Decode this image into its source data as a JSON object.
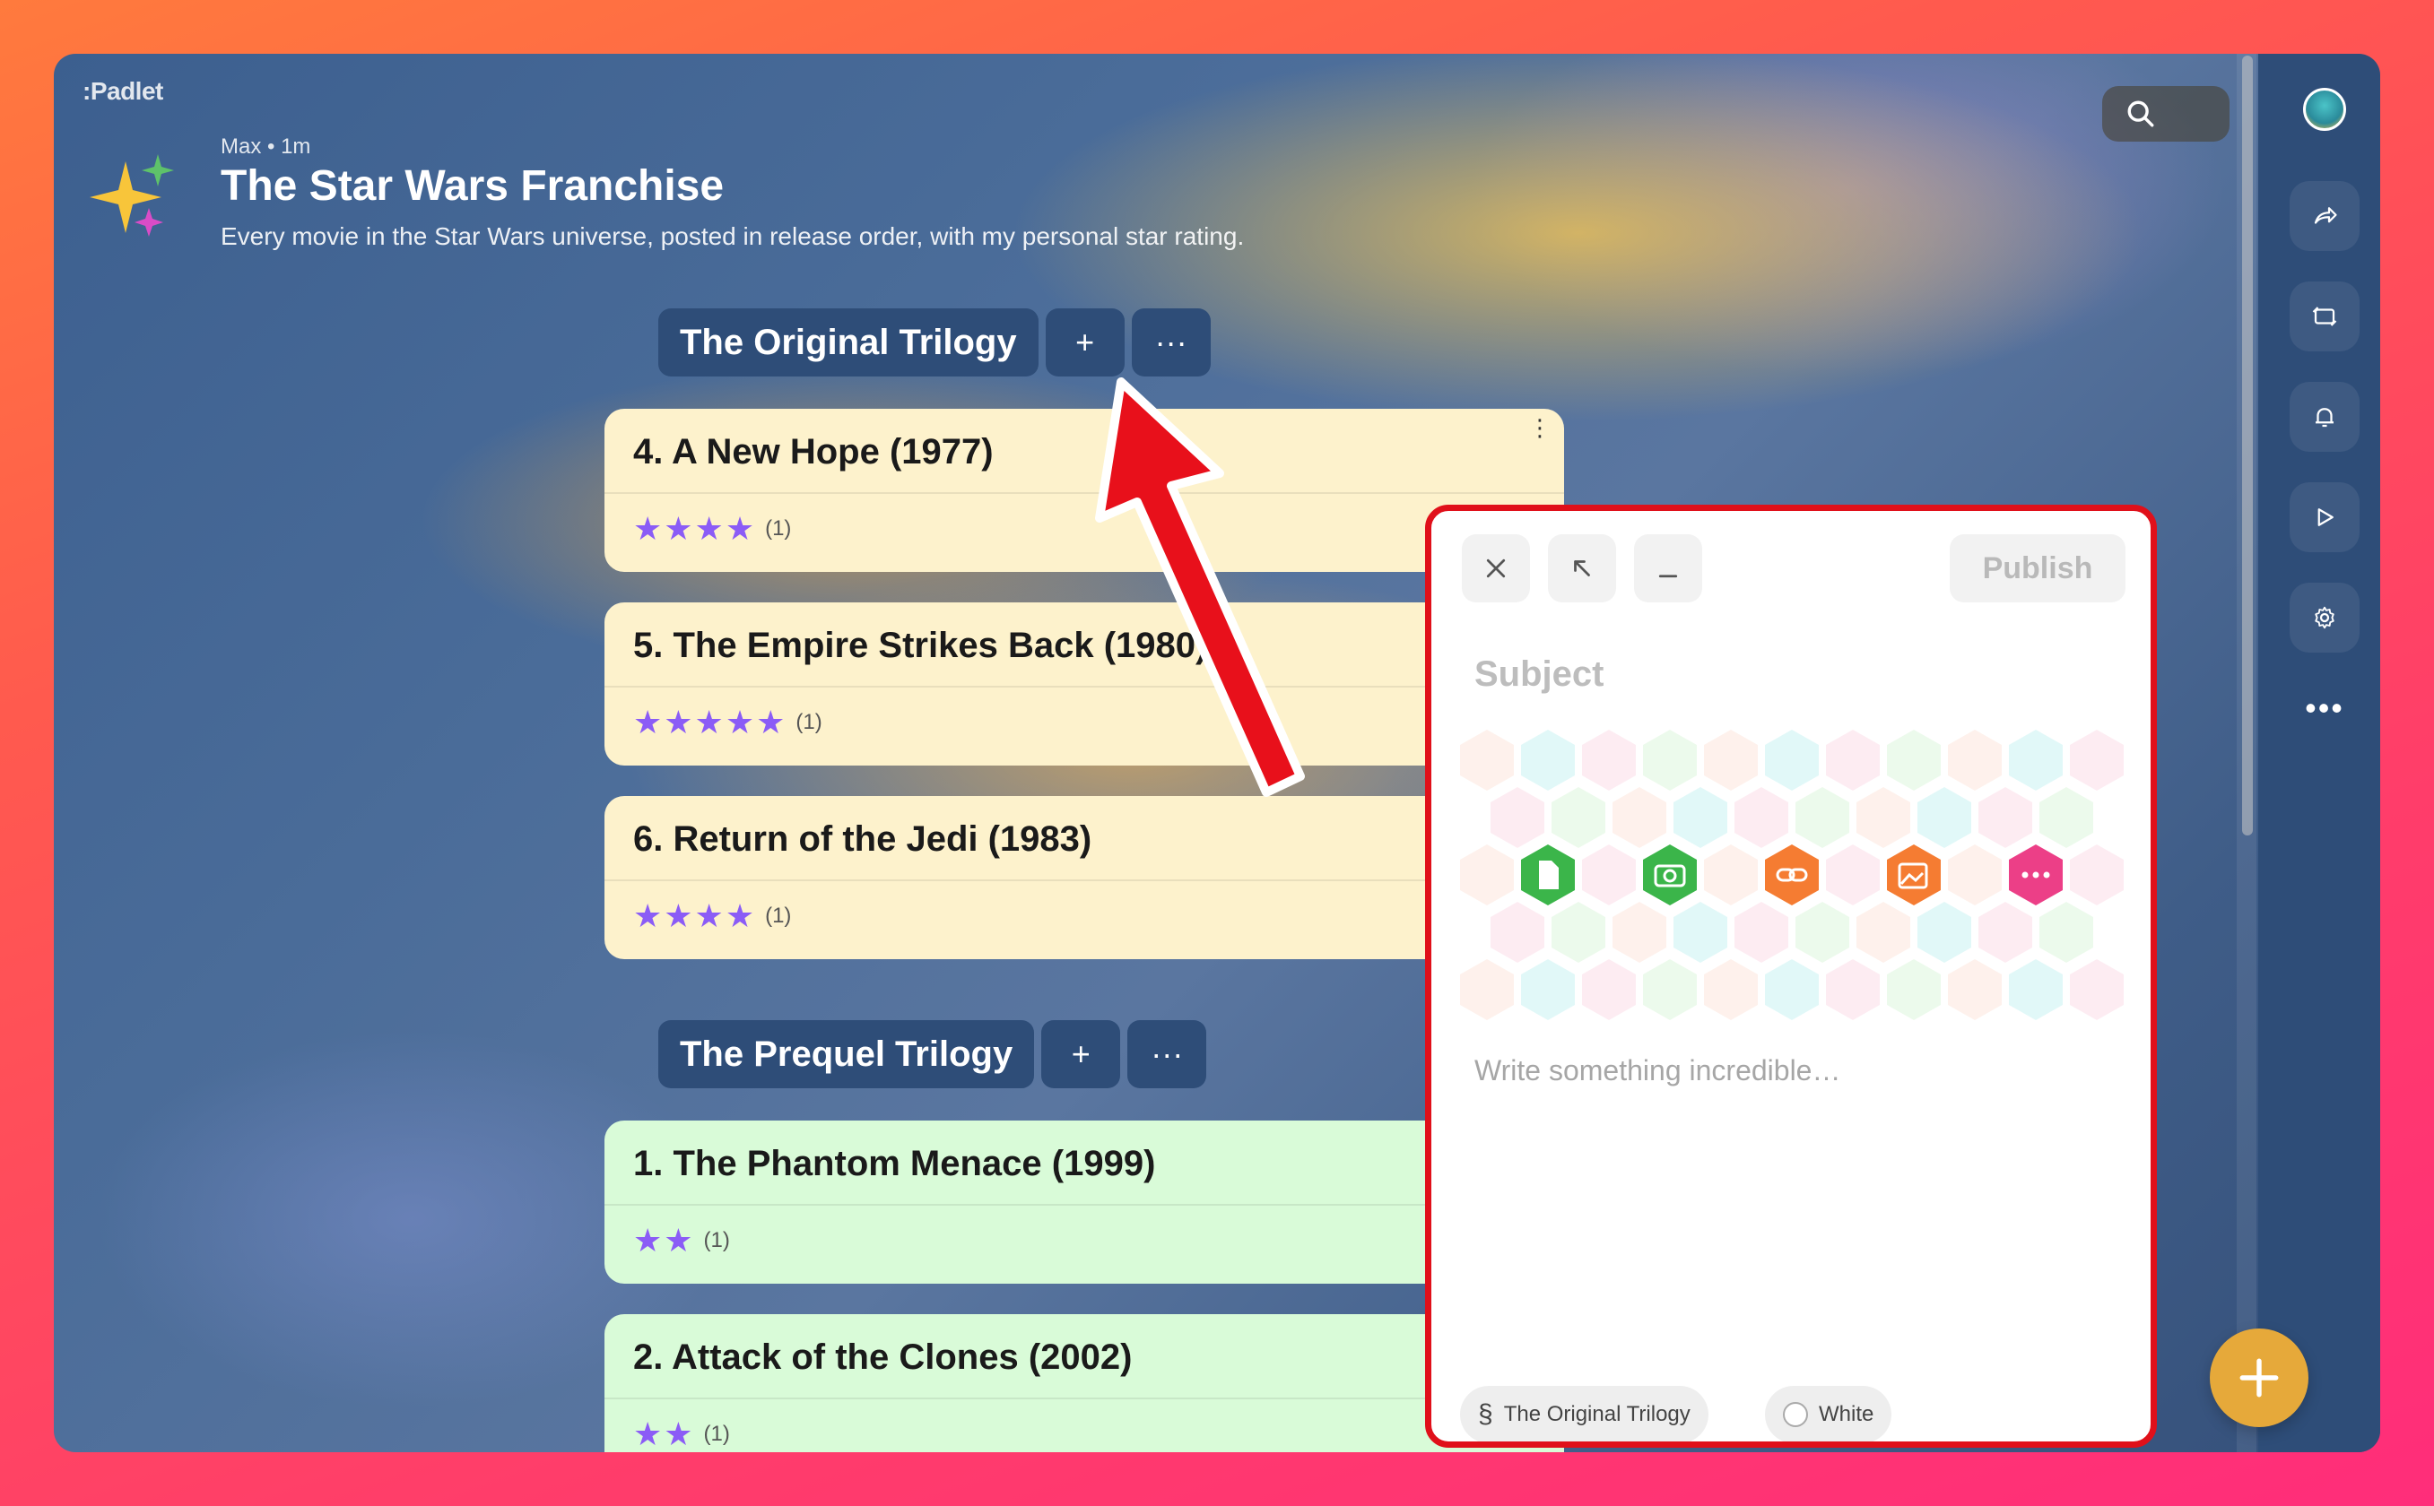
{
  "app": {
    "logo": ":Padlet"
  },
  "board": {
    "author": "Max",
    "age": "• 1m",
    "title": "The Star Wars Franchise",
    "description": "Every movie in the Star Wars universe, posted in release order, with my personal star rating."
  },
  "sections": [
    {
      "title": "The Original Trilogy",
      "add_label": "+",
      "more_label": "···",
      "color": "#fdf2cc",
      "posts": [
        {
          "title": "4. A New Hope (1977)",
          "stars": "★★★★",
          "rating": 4,
          "count": "(1)"
        },
        {
          "title": "5. The Empire Strikes Back (1980)",
          "stars": "★★★★★",
          "rating": 5,
          "count": "(1)"
        },
        {
          "title": "6. Return of the Jedi (1983)",
          "stars": "★★★★",
          "rating": 4,
          "count": "(1)"
        }
      ]
    },
    {
      "title": "The Prequel Trilogy",
      "add_label": "+",
      "more_label": "···",
      "color": "#d9fbd8",
      "posts": [
        {
          "title": "1. The Phantom Menace (1999)",
          "stars": "★★",
          "rating": 2,
          "count": "(1)"
        },
        {
          "title": "2. Attack of the Clones (2002)",
          "stars": "★★",
          "rating": 2,
          "count": "(1)"
        }
      ]
    }
  ],
  "composer": {
    "close_icon": "close-icon",
    "expand_icon": "expand-arrow-icon",
    "minimize_icon": "minimize-icon",
    "publish_label": "Publish",
    "subject_placeholder": "Subject",
    "body_placeholder": "Write something incredible…",
    "attachments": [
      {
        "name": "upload-file-icon",
        "color": "#3bb54a"
      },
      {
        "name": "camera-icon",
        "color": "#3bb54a"
      },
      {
        "name": "link-icon",
        "color": "#f57c32"
      },
      {
        "name": "image-search-icon",
        "color": "#f57c32"
      },
      {
        "name": "more-attachments-icon",
        "color": "#ec3f87"
      }
    ],
    "section_chip": {
      "symbol": "§",
      "label": "The Original Trilogy"
    },
    "color_chip": {
      "label": "White"
    }
  },
  "rail": {
    "icons": [
      "avatar",
      "share-icon",
      "remake-icon",
      "bell-icon",
      "play-icon",
      "gear-icon",
      "more-icon"
    ],
    "more_label": "•••"
  },
  "colors": {
    "accent_fab": "#e6a93a",
    "rail": "#2e4d78",
    "star": "#8b5cf6",
    "highlight": "#e0101a"
  }
}
